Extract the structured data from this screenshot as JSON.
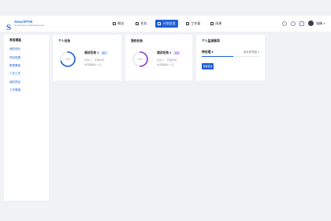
{
  "app": {
    "name": "SmartPTM",
    "tagline": "Smart Project & Task Management"
  },
  "nav": {
    "items": [
      {
        "label": "概览",
        "active": false
      },
      {
        "label": "任务",
        "active": false
      },
      {
        "label": "计划总览",
        "active": true
      },
      {
        "label": "工作量",
        "active": false
      },
      {
        "label": "成果",
        "active": false
      }
    ]
  },
  "user": {
    "name": "张峰"
  },
  "sidebar": {
    "title": "常用模板",
    "items": [
      {
        "label": "我的待办"
      },
      {
        "label": "项目进展"
      },
      {
        "label": "数据看板"
      },
      {
        "label": "人员工作"
      },
      {
        "label": "我的项目"
      },
      {
        "label": "工作周报"
      }
    ]
  },
  "cards": {
    "personal": {
      "title": "个人任务",
      "menu": "···",
      "ring_label": "70%",
      "ring_percent": 70,
      "task_name": "测试任务 1",
      "tag": "进行",
      "meta1": "负责人：  开始时间：",
      "meta2": "本周期剩余 2 天"
    },
    "mine": {
      "title": "我的任务",
      "menu": "···",
      "ring_label": "50%",
      "ring_percent": 50,
      "task_name": "测试任务 2",
      "tag": "延期",
      "meta1": "负责人：  开始时间：",
      "meta2": "本周期剩余 1 天"
    },
    "mgmt": {
      "title": "个人监测事项",
      "label": "待处理 3",
      "right_text": "近半年项目 1",
      "progress": 0.55,
      "button_label": "查看更多"
    }
  },
  "colors": {
    "primary": "#1e5fd6",
    "purple": "#8a3fd6",
    "track": "#e6e8eb"
  }
}
